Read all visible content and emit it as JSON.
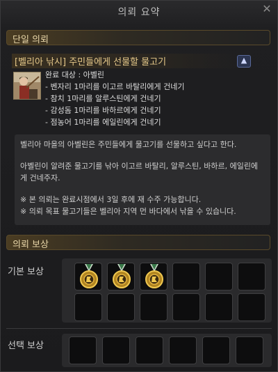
{
  "window": {
    "title": "의뢰 요약",
    "close_icon": "close-icon"
  },
  "section_single": {
    "label": "단일 의뢰"
  },
  "quest": {
    "title": "[벨리아 낚시] 주민들에게 선물할 물고기",
    "completion_target": "완료 대상 : 아벨린",
    "objectives": [
      "- 벤자리 1마리를 이고르 바탈리에게 건네기",
      "- 참치 1마리를 알루스틴에게 건네기",
      "- 감성돔 1마리를 바하르에게 건네기",
      "- 점농어 1마리를 에일린에게 건네기"
    ],
    "description": [
      "벨리아 마을의 아벨린은 주민들에게 물고기를 선물하고 싶다고 한다.",
      "아벨린이 알려준 물고기를 낚아 이고르 바탈리, 알루스틴, 바하르, 에일린에게 건네주자.",
      "※ 본 의뢰는 완료시점에서 3일 후에 재 수주 가능합니다.",
      "※ 의뢰 목표 물고기들은 벨리아 지역 먼 바다에서 낚을 수 있습니다."
    ]
  },
  "section_reward": {
    "label": "의뢰 보상"
  },
  "rewards": {
    "basic_label": "기본 보상",
    "select_label": "선택 보상",
    "basic_filled": [
      "medal-icon",
      "medal-icon",
      "medal-icon"
    ]
  },
  "colors": {
    "accent": "#e6c98a",
    "panel": "#2c2c2e",
    "slot": "#0d0d0e"
  }
}
